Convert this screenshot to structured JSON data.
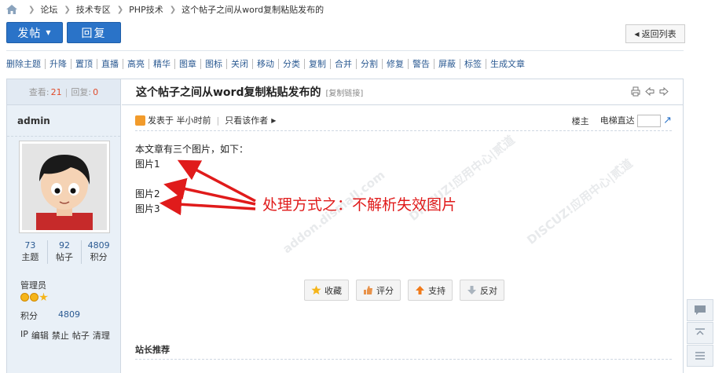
{
  "breadcrumb": [
    "论坛",
    "技术专区",
    "PHP技术",
    "这个帖子之间从word复制粘贴发布的"
  ],
  "buttons": {
    "post": "发帖",
    "reply": "回复",
    "back": "返回列表"
  },
  "mod_actions": [
    "删除主题",
    "升降",
    "置顶",
    "直播",
    "高亮",
    "精华",
    "图章",
    "图标",
    "关闭",
    "移动",
    "分类",
    "复制",
    "合并",
    "分割",
    "修复",
    "警告",
    "屏蔽",
    "标签",
    "生成文章"
  ],
  "stats": {
    "views_label": "查看:",
    "views": "21",
    "replies_label": "回复:",
    "replies": "0"
  },
  "user": {
    "name": "admin",
    "counts": [
      {
        "value": "73",
        "label": "主题"
      },
      {
        "value": "92",
        "label": "帖子"
      },
      {
        "value": "4809",
        "label": "积分"
      }
    ],
    "group": "管理员",
    "score_label": "积分",
    "score": "4809",
    "links": [
      "IP",
      "编辑",
      "禁止",
      "帖子",
      "清理"
    ]
  },
  "post": {
    "title": "这个帖子之间从word复制粘贴发布的",
    "copy_link": "[复制链接]",
    "posted": "发表于 半小时前",
    "only_author": "只看该作者",
    "floor": "楼主",
    "elevator": "电梯直达",
    "lines": [
      "本文章有三个图片，如下：",
      "图片1",
      "",
      "图片2",
      "图片3"
    ],
    "annotation": "处理方式之：不解析失效图片"
  },
  "watermark": {
    "line1": "DISCUZ!应用中心|贰道",
    "line2": "addon.dismall.com"
  },
  "post_actions": [
    "收藏",
    "评分",
    "支持",
    "反对"
  ],
  "recommend_title": "站长推荐",
  "colors": {
    "primary_button": "#2a73c8",
    "link": "#2b5a92",
    "highlight": "#e04b2b",
    "annotation": "#e01b1b"
  }
}
